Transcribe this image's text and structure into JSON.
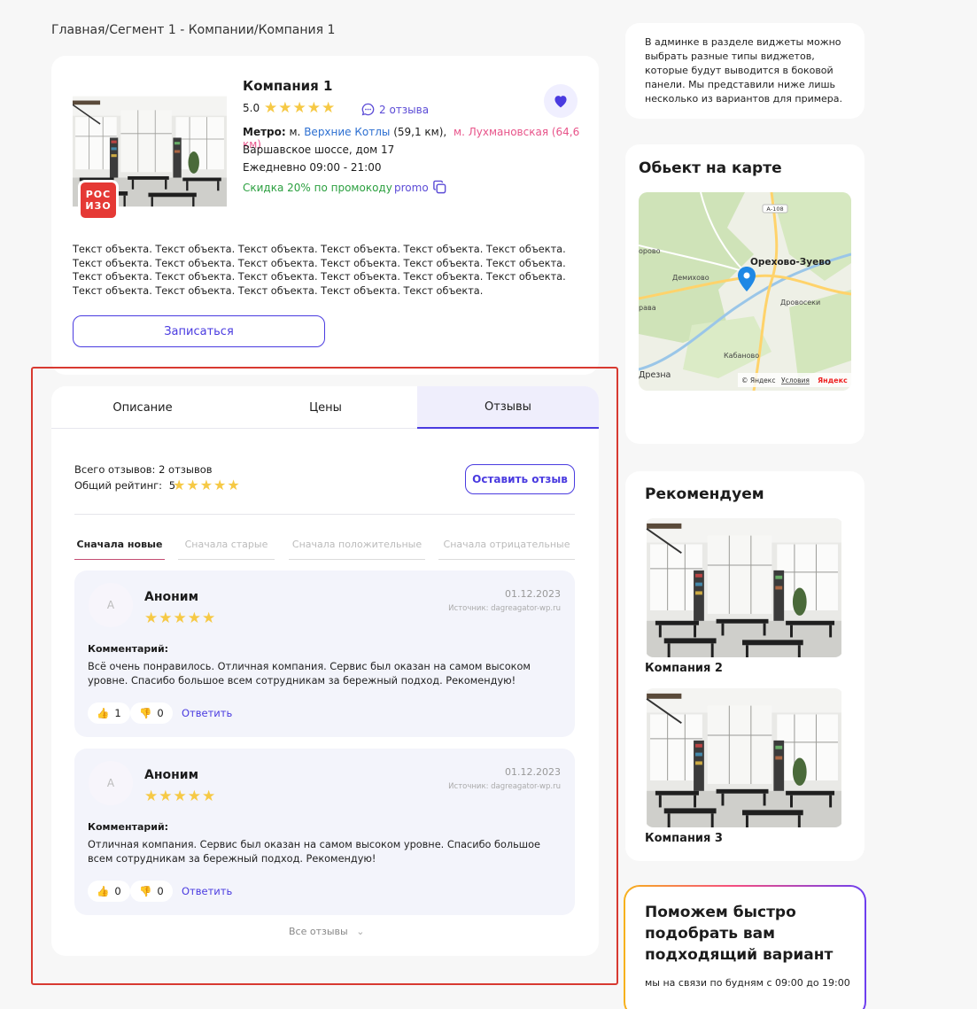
{
  "breadcrumb": "Главная/Сегмент 1 - Компании/Компания 1",
  "company": {
    "logo_text": "РОС ИЗО",
    "name": "Компания 1",
    "rating": "5.0",
    "stars": "★★★★★",
    "reviews_link": "2 отзыва",
    "metro_label": "Метро:",
    "metro_1_prefix": "м.",
    "metro_1_name": "Верхние Котлы",
    "metro_1_dist": "(59,1 км),",
    "metro_2": "м. Лухмановская (64,6 км)",
    "address": "Варшавское шоссе, дом 17",
    "hours": "Ежедневно 09:00 - 21:00",
    "promo_text": "Скидка 20% по промокоду",
    "promo_code": "promo",
    "description": "Текст объекта. Текст объекта. Текст объекта. Текст объекта. Текст объекта. Текст объекта. Текст объекта. Текст объекта. Текст объекта. Текст объекта. Текст объекта. Текст объекта. Текст объекта. Текст объекта. Текст объекта. Текст объекта. Текст объекта. Текст объекта. Текст объекта. Текст объекта. Текст объекта. Текст объекта. Текст объекта.",
    "signup_label": "Записаться"
  },
  "tabs": [
    "Описание",
    "Цены",
    "Отзывы"
  ],
  "reviews_summary": {
    "total": "Всего отзывов: 2 отзывов",
    "overall_label": "Общий рейтинг:",
    "overall_value": "5",
    "stars": "★★★★★",
    "leave_label": "Оставить отзыв"
  },
  "sort_options": [
    "Сначала новые",
    "Сначала старые",
    "Сначала положительные",
    "Сначала отрицательные"
  ],
  "reviews": [
    {
      "avatar": "А",
      "name": "Аноним",
      "stars": "★★★★★",
      "date": "01.12.2023",
      "source": "Источник: dagreagator-wp.ru",
      "comment_label": "Комментарий:",
      "text": "Всё очень понравилось. Отличная компания. Сервис был оказан на самом высоком уровне. Спасибо большое всем сотрудникам за бережный подход. Рекомендую!",
      "likes": "1",
      "dislikes": "0",
      "reply": "Ответить"
    },
    {
      "avatar": "А",
      "name": "Аноним",
      "stars": "★★★★★",
      "date": "01.12.2023",
      "source": "Источник: dagreagator-wp.ru",
      "comment_label": "Комментарий:",
      "text": "Отличная компания. Сервис был оказан на самом высоком уровне. Спасибо большое всем сотрудникам за бережный подход. Рекомендую!",
      "likes": "0",
      "dislikes": "0",
      "reply": "Ответить"
    }
  ],
  "all_reviews": "Все отзывы",
  "sidebar": {
    "note": "В админке в разделе виджеты можно выбрать разные типы виджетов, которые будут выводится в боковой панели. Мы представили ниже лишь несколько из вариантов для примера.",
    "map_title": "Обьект на карте",
    "map": {
      "city": "Орехово-Зуево",
      "labels": [
        "орово",
        "Демихово",
        "Дровосеки",
        "рава",
        "Кабаново",
        "Дрезна"
      ],
      "road": "А-108",
      "copyright": "© Яндекс",
      "terms": "Условия",
      "brand": "Яндекс"
    },
    "recommend_title": "Рекомендуем",
    "recommend_items": [
      "Компания 2",
      "Компания 3"
    ],
    "help_title": "Поможем быстро подобрать вам подходящий вариант",
    "help_sub": "мы на связи по будням с 09:00 до 19:00"
  }
}
